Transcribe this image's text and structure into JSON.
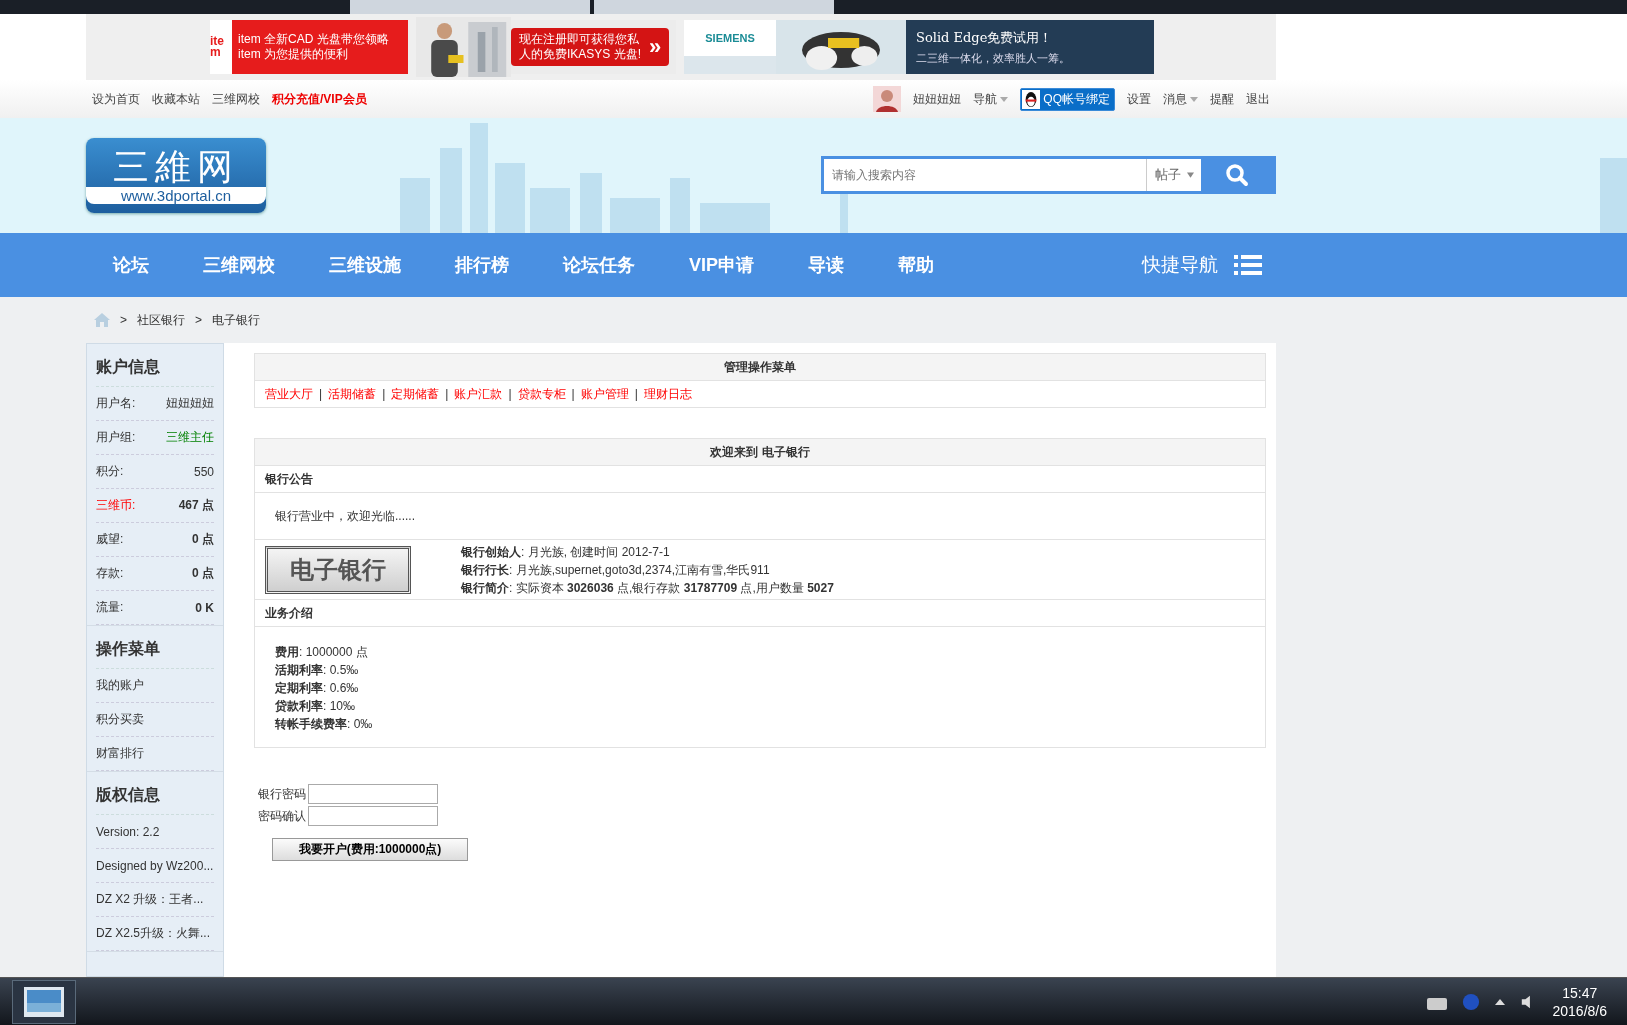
{
  "ad_banner": {
    "brand": "item",
    "item_lines": [
      "item 全新CAD 光盘带您领略",
      "item 为您提供的便利"
    ],
    "promo_lines": [
      "现在注册即可获得您私",
      "人的免费IKASYS 光盘!"
    ],
    "promo_arrow": "»",
    "siemens": "SIEMENS",
    "solid_title": "Solid Edge免费试用！",
    "solid_sub": "二三维一体化，效率胜人一筹。"
  },
  "top_links": [
    {
      "label": "设为首页",
      "highlight": false
    },
    {
      "label": "收藏本站",
      "highlight": false
    },
    {
      "label": "三维网校",
      "highlight": false
    },
    {
      "label": "积分充值/VIP会员",
      "highlight": true
    }
  ],
  "user_bar": {
    "username": "妞妞妞妞",
    "qq_button": "QQ帐号绑定",
    "items_before": [
      {
        "label": "导航",
        "dropdown": true
      }
    ],
    "items_after": [
      {
        "label": "设置",
        "dropdown": false
      },
      {
        "label": "消息",
        "dropdown": true
      },
      {
        "label": "提醒",
        "dropdown": false
      },
      {
        "label": "退出",
        "dropdown": false
      }
    ]
  },
  "logo": {
    "title": "三維网",
    "url": "www.3dportal.cn"
  },
  "search": {
    "placeholder": "请输入搜索内容",
    "type": "帖子"
  },
  "nav": {
    "items": [
      "论坛",
      "三维网校",
      "三维设施",
      "排行榜",
      "论坛任务",
      "VIP申请",
      "导读",
      "帮助"
    ],
    "quick": "快捷导航"
  },
  "breadcrumb": {
    "separator": ">",
    "items": [
      "社区银行",
      "电子银行"
    ]
  },
  "sidebar": [
    {
      "title": "账户信息",
      "rows": [
        {
          "kind": "pair",
          "label": "用户名:",
          "value": "妞妞妞妞",
          "bold": false,
          "label_alert": false,
          "value_positive": false
        },
        {
          "kind": "pair",
          "label": "用户组:",
          "value": "三维主任",
          "bold": false,
          "label_alert": false,
          "value_positive": true
        },
        {
          "kind": "pair",
          "label": "积分:",
          "value": "550",
          "bold": false,
          "label_alert": false,
          "value_positive": false
        },
        {
          "kind": "pair",
          "label": "三维币:",
          "value": "467 点",
          "bold": true,
          "label_alert": true,
          "value_positive": false
        },
        {
          "kind": "pair",
          "label": "威望:",
          "value": "0 点",
          "bold": true,
          "label_alert": false,
          "value_positive": false
        },
        {
          "kind": "pair",
          "label": "存款:",
          "value": "0 点",
          "bold": true,
          "label_alert": false,
          "value_positive": false
        },
        {
          "kind": "pair",
          "label": "流量:",
          "value": "0 K",
          "bold": true,
          "label_alert": false,
          "value_positive": false
        }
      ]
    },
    {
      "title": "操作菜单",
      "rows": [
        {
          "kind": "link",
          "label": "我的账户"
        },
        {
          "kind": "link",
          "label": "积分买卖"
        },
        {
          "kind": "link",
          "label": "财富排行"
        }
      ]
    },
    {
      "title": "版权信息",
      "rows": [
        {
          "kind": "text",
          "label": "Version: 2.2"
        },
        {
          "kind": "text",
          "label": "Designed by Wz200..."
        },
        {
          "kind": "text",
          "label": "DZ X2 升级：王者..."
        },
        {
          "kind": "text",
          "label": "DZ X2.5升级：火舞..."
        }
      ]
    }
  ],
  "menu_panel": {
    "title": "管理操作菜单",
    "separator": "|",
    "links": [
      "营业大厅",
      "活期储蓄",
      "定期储蓄",
      "账户汇款",
      "贷款专柜",
      "账户管理",
      "理财日志"
    ]
  },
  "welcome_panel": {
    "title": "欢迎来到 电子银行",
    "notice_heading": "银行公告",
    "notice": "银行营业中，欢迎光临......",
    "badge": "电子银行",
    "info": [
      "**银行创始人**: 月光族, 创建时间 2012-7-1",
      "**银行行长**: 月光族,supernet,goto3d,2374,江南有雪,华氏911",
      "**银行简介**: 实际资本 **3026036** 点,银行存款 **31787709** 点,用户数量 **5027**"
    ],
    "business_heading": "业务介绍",
    "business": [
      "**费用**: 1000000 点",
      "**活期利率**: 0.5‰",
      "**定期利率**: 0.6‰",
      "**贷款利率**: 10‰",
      "**转帐手续费率**: 0‰"
    ]
  },
  "form": {
    "fields": [
      {
        "label": "银行密码"
      },
      {
        "label": "密码确认"
      }
    ],
    "button": "我要开户(费用:1000000点)"
  },
  "taskbar": {
    "time": "15:47",
    "date": "2016/8/6"
  }
}
